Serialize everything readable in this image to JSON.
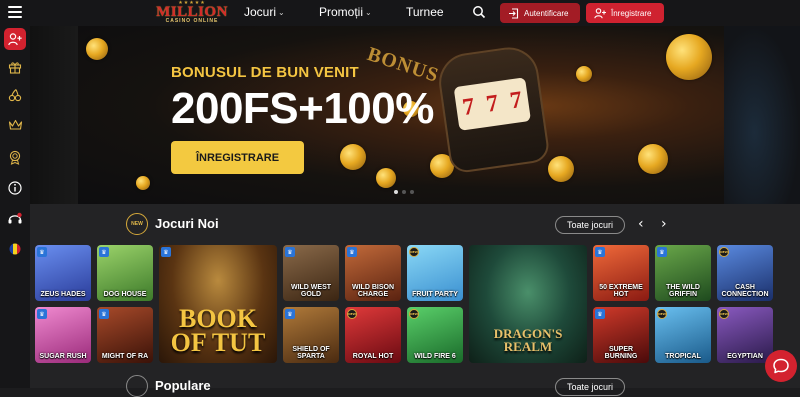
{
  "header": {
    "logo_main": "MILLION",
    "logo_sub": "CASINO ONLINE",
    "logo_stars": "★★★★★",
    "nav": [
      {
        "label": "Jocuri"
      },
      {
        "label": "Promoții"
      },
      {
        "label": "Turnee"
      }
    ],
    "login_label": "Autentificare",
    "register_label": "Înregistrare"
  },
  "sidebar": {
    "items": [
      {
        "icon": "user-plus-icon"
      },
      {
        "icon": "gift-icon"
      },
      {
        "icon": "cherries-icon"
      },
      {
        "icon": "crown-icon"
      },
      {
        "icon": "vip-badge-icon"
      },
      {
        "icon": "info-icon"
      },
      {
        "icon": "support-icon"
      },
      {
        "icon": "language-flag-icon"
      }
    ]
  },
  "hero": {
    "title": "BONUSUL DE BUN VENIT",
    "offer": "200FS+100%",
    "button_label": "ÎNREGISTRARE",
    "bonus_sign": "BONUS",
    "reels": [
      "7",
      "7",
      "7"
    ]
  },
  "section_new": {
    "badge": "NEW",
    "title": "Jocuri Noi",
    "all_label": "Toate jocuri"
  },
  "games": [
    {
      "name": "ZEUS HADES",
      "color": "#3c5fd0"
    },
    {
      "name": "DOG HOUSE",
      "color": "#5aa23d"
    },
    {
      "name": "BOOK OF TUT",
      "color": "#6b3b12"
    },
    {
      "name": "WILD WEST GOLD",
      "color": "#5a3a22"
    },
    {
      "name": "WILD BISON CHARGE",
      "color": "#8a3b20"
    },
    {
      "name": "FRUIT PARTY",
      "color": "#46b0e6"
    },
    {
      "name": "DRAGON'S REALM",
      "color": "#1e4a3a"
    },
    {
      "name": "50 EXTREME HOT",
      "color": "#c7372b"
    },
    {
      "name": "THE WILD GRIFFIN",
      "color": "#2c6a2c"
    },
    {
      "name": "CASH CONNECTION",
      "color": "#2a4f9c"
    },
    {
      "name": "SUGAR RUSH",
      "color": "#d44aa0"
    },
    {
      "name": "MIGHT OF RA",
      "color": "#6e2c19"
    },
    {
      "name": "SHIELD OF SPARTA",
      "color": "#7a4b1c"
    },
    {
      "name": "ROYAL HOT",
      "color": "#b01d2a"
    },
    {
      "name": "WILD FIRE 6",
      "color": "#2c9b3c"
    },
    {
      "name": "SUPER BURNING",
      "color": "#8a1a1a"
    },
    {
      "name": "TROPICAL",
      "color": "#2a9ad0"
    },
    {
      "name": "EGYPTIAN",
      "color": "#4f2f6b"
    }
  ],
  "section_popular": {
    "title": "Populare",
    "all_label": "Toate jocuri"
  }
}
